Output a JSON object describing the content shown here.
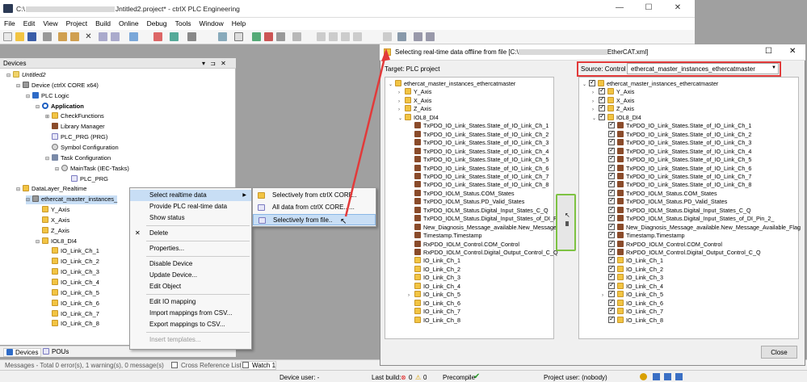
{
  "window": {
    "title_prefix": "C:\\",
    "title_suffix": "Jntitled2.project* - ctrlX PLC Engineering",
    "minimize": "—",
    "maximize": "☐",
    "close": "✕"
  },
  "menu": [
    "File",
    "Edit",
    "View",
    "Project",
    "Build",
    "Online",
    "Debug",
    "Tools",
    "Window",
    "Help"
  ],
  "devices": {
    "header": "Devices",
    "pin": "▾ ⊐ ✕",
    "tree": [
      {
        "label": "Untitled2",
        "indent": 0,
        "icon": "i-doc",
        "exp": "⊟",
        "bold": false,
        "italic": true
      },
      {
        "label": "Device (ctrlX CORE x64)",
        "indent": 1,
        "icon": "i-dev",
        "exp": "⊟"
      },
      {
        "label": "PLC Logic",
        "indent": 2,
        "icon": "i-blue",
        "exp": "⊟"
      },
      {
        "label": "Application",
        "indent": 3,
        "icon": "i-app",
        "exp": "⊟",
        "bold": true
      },
      {
        "label": "CheckFunctions",
        "indent": 4,
        "icon": "i-fold",
        "exp": "⊞"
      },
      {
        "label": "Library Manager",
        "indent": 4,
        "icon": "i-lib",
        "exp": ""
      },
      {
        "label": "PLC_PRG (PRG)",
        "indent": 4,
        "icon": "i-prg",
        "exp": ""
      },
      {
        "label": "Symbol Configuration",
        "indent": 4,
        "icon": "i-gear",
        "exp": ""
      },
      {
        "label": "Task Configuration",
        "indent": 4,
        "icon": "i-ml",
        "exp": "⊟"
      },
      {
        "label": "MainTask (IEC-Tasks)",
        "indent": 5,
        "icon": "i-gear",
        "exp": "⊟"
      },
      {
        "label": "PLC_PRG",
        "indent": 6,
        "icon": "i-prg",
        "exp": ""
      },
      {
        "label": "DataLayer_Realtime",
        "indent": 1,
        "icon": "i-fold",
        "exp": "⊟"
      },
      {
        "label": "ethercat_master_instances_",
        "indent": 2,
        "icon": "i-dev",
        "exp": "⊟"
      },
      {
        "label": "Y_Axis",
        "indent": 3,
        "icon": "i-fold",
        "exp": ""
      },
      {
        "label": "X_Axis",
        "indent": 3,
        "icon": "i-fold",
        "exp": ""
      },
      {
        "label": "Z_Axis",
        "indent": 3,
        "icon": "i-fold",
        "exp": ""
      },
      {
        "label": "IOL8_DI4",
        "indent": 3,
        "icon": "i-fold",
        "exp": "⊟"
      },
      {
        "label": "IO_Link_Ch_1",
        "indent": 4,
        "icon": "i-fold",
        "exp": ""
      },
      {
        "label": "IO_Link_Ch_2",
        "indent": 4,
        "icon": "i-fold",
        "exp": ""
      },
      {
        "label": "IO_Link_Ch_3",
        "indent": 4,
        "icon": "i-fold",
        "exp": ""
      },
      {
        "label": "IO_Link_Ch_4",
        "indent": 4,
        "icon": "i-fold",
        "exp": ""
      },
      {
        "label": "IO_Link_Ch_5",
        "indent": 4,
        "icon": "i-fold",
        "exp": ""
      },
      {
        "label": "IO_Link_Ch_6",
        "indent": 4,
        "icon": "i-fold",
        "exp": ""
      },
      {
        "label": "IO_Link_Ch_7",
        "indent": 4,
        "icon": "i-fold",
        "exp": ""
      },
      {
        "label": "IO_Link_Ch_8",
        "indent": 4,
        "icon": "i-fold",
        "exp": ""
      }
    ]
  },
  "context_menu": [
    {
      "label": "Select realtime data",
      "arrow": "▶",
      "sel": true
    },
    {
      "label": "Provide PLC real-time data"
    },
    {
      "label": "Show status"
    },
    {
      "sep": true
    },
    {
      "label": "Delete",
      "icon": "✕"
    },
    {
      "sep": true
    },
    {
      "label": "Properties..."
    },
    {
      "sep": true
    },
    {
      "label": "Disable Device"
    },
    {
      "label": "Update Device..."
    },
    {
      "label": "Edit Object"
    },
    {
      "sep": true
    },
    {
      "label": "Edit IO mapping"
    },
    {
      "label": "Import mappings from CSV..."
    },
    {
      "label": "Export mappings to CSV..."
    },
    {
      "sep": true
    },
    {
      "label": "Insert templates...",
      "disabled": true
    }
  ],
  "submenu": [
    "Selectively from ctrlX CORE..",
    "All data from ctrlX CORE......",
    "Selectively from file.."
  ],
  "bottom_tabs": [
    "Devices",
    "POUs"
  ],
  "status": {
    "messages": "Messages - Total 0 error(s), 1 warning(s), 0 message(s)",
    "cross_ref": "Cross Reference List",
    "watch": "Watch 1",
    "device_user": "Device user: -",
    "last_build": "Last build:",
    "errors": "0",
    "warnings": "0",
    "precompile": "Precompile",
    "project_user": "Project user: (nobody)"
  },
  "dialog": {
    "title_prefix": "Selecting real-time data offline from file [C:\\",
    "title_suffix": "EtherCAT.xml]",
    "target_label": "Target: PLC project",
    "source_label": "Source: Control",
    "source_value": "ethercat_master_instances_ethercatmaster",
    "close_button": "Close",
    "left_tree": [
      {
        "label": "ethercat_master_instances_ethercatmaster",
        "indent": 0,
        "exp": "⌄",
        "icon": "i-fold"
      },
      {
        "label": "Y_Axis",
        "indent": 1,
        "exp": "›",
        "icon": "i-fold"
      },
      {
        "label": "X_Axis",
        "indent": 1,
        "exp": "›",
        "icon": "i-fold"
      },
      {
        "label": "Z_Axis",
        "indent": 1,
        "exp": "›",
        "icon": "i-fold"
      },
      {
        "label": "IOL8_DI4",
        "indent": 1,
        "exp": "⌄",
        "icon": "i-fold"
      },
      {
        "label": "TxPDO_IO_Link_States.State_of_IO_Link_Ch_1",
        "indent": 2,
        "icon": "i-lib"
      },
      {
        "label": "TxPDO_IO_Link_States.State_of_IO_Link_Ch_2",
        "indent": 2,
        "icon": "i-lib"
      },
      {
        "label": "TxPDO_IO_Link_States.State_of_IO_Link_Ch_3",
        "indent": 2,
        "icon": "i-lib"
      },
      {
        "label": "TxPDO_IO_Link_States.State_of_IO_Link_Ch_4",
        "indent": 2,
        "icon": "i-lib"
      },
      {
        "label": "TxPDO_IO_Link_States.State_of_IO_Link_Ch_5",
        "indent": 2,
        "icon": "i-lib"
      },
      {
        "label": "TxPDO_IO_Link_States.State_of_IO_Link_Ch_6",
        "indent": 2,
        "icon": "i-lib"
      },
      {
        "label": "TxPDO_IO_Link_States.State_of_IO_Link_Ch_7",
        "indent": 2,
        "icon": "i-lib"
      },
      {
        "label": "TxPDO_IO_Link_States.State_of_IO_Link_Ch_8",
        "indent": 2,
        "icon": "i-lib"
      },
      {
        "label": "TxPDO_IOLM_Status.COM_States",
        "indent": 2,
        "icon": "i-lib"
      },
      {
        "label": "TxPDO_IOLM_Status.PD_Valid_States",
        "indent": 2,
        "icon": "i-lib"
      },
      {
        "label": "TxPDO_IOLM_Status.Digital_Input_States_C_Q",
        "indent": 2,
        "icon": "i-lib"
      },
      {
        "label": "TxPDO_IOLM_Status.Digital_Input_States_of_DI_Pi",
        "indent": 2,
        "icon": "i-lib"
      },
      {
        "label": "New_Diagnosis_Message_available.New_Message_",
        "indent": 2,
        "icon": "i-lib"
      },
      {
        "label": "Timestamp.Timestamp",
        "indent": 2,
        "icon": "i-lib"
      },
      {
        "label": "RxPDO_IOLM_Control.COM_Control",
        "indent": 2,
        "icon": "i-lib"
      },
      {
        "label": "RxPDO_IOLM_Control.Digital_Output_Control_C_Q",
        "indent": 2,
        "icon": "i-lib"
      },
      {
        "label": "IO_Link_Ch_1",
        "indent": 2,
        "icon": "i-fold"
      },
      {
        "label": "IO_Link_Ch_2",
        "indent": 2,
        "icon": "i-fold"
      },
      {
        "label": "IO_Link_Ch_3",
        "indent": 2,
        "icon": "i-fold"
      },
      {
        "label": "IO_Link_Ch_4",
        "indent": 2,
        "icon": "i-fold"
      },
      {
        "label": "IO_Link_Ch_5",
        "indent": 2,
        "exp": "›",
        "icon": "i-fold"
      },
      {
        "label": "IO_Link_Ch_6",
        "indent": 2,
        "icon": "i-fold"
      },
      {
        "label": "IO_Link_Ch_7",
        "indent": 2,
        "icon": "i-fold"
      },
      {
        "label": "IO_Link_Ch_8",
        "indent": 2,
        "icon": "i-fold"
      }
    ],
    "right_tree": [
      {
        "label": "ethercat_master_instances_ethercatmaster",
        "indent": 0,
        "exp": "⌄",
        "icon": "i-fold"
      },
      {
        "label": "Y_Axis",
        "indent": 1,
        "exp": "›",
        "icon": "i-fold"
      },
      {
        "label": "X_Axis",
        "indent": 1,
        "exp": "›",
        "icon": "i-fold"
      },
      {
        "label": "Z_Axis",
        "indent": 1,
        "exp": "›",
        "icon": "i-fold"
      },
      {
        "label": "IOL8_DI4",
        "indent": 1,
        "exp": "⌄",
        "icon": "i-fold"
      },
      {
        "label": "TxPDO_IO_Link_States.State_of_IO_Link_Ch_1",
        "indent": 2,
        "icon": "i-lib"
      },
      {
        "label": "TxPDO_IO_Link_States.State_of_IO_Link_Ch_2",
        "indent": 2,
        "icon": "i-lib"
      },
      {
        "label": "TxPDO_IO_Link_States.State_of_IO_Link_Ch_3",
        "indent": 2,
        "icon": "i-lib"
      },
      {
        "label": "TxPDO_IO_Link_States.State_of_IO_Link_Ch_4",
        "indent": 2,
        "icon": "i-lib"
      },
      {
        "label": "TxPDO_IO_Link_States.State_of_IO_Link_Ch_5",
        "indent": 2,
        "icon": "i-lib"
      },
      {
        "label": "TxPDO_IO_Link_States.State_of_IO_Link_Ch_6",
        "indent": 2,
        "icon": "i-lib"
      },
      {
        "label": "TxPDO_IO_Link_States.State_of_IO_Link_Ch_7",
        "indent": 2,
        "icon": "i-lib"
      },
      {
        "label": "TxPDO_IO_Link_States.State_of_IO_Link_Ch_8",
        "indent": 2,
        "icon": "i-lib"
      },
      {
        "label": "TxPDO_IOLM_Status.COM_States",
        "indent": 2,
        "icon": "i-lib"
      },
      {
        "label": "TxPDO_IOLM_Status.PD_Valid_States",
        "indent": 2,
        "icon": "i-lib"
      },
      {
        "label": "TxPDO_IOLM_Status.Digital_Input_States_C_Q",
        "indent": 2,
        "icon": "i-lib"
      },
      {
        "label": "TxPDO_IOLM_Status.Digital_Input_States_of_DI_Pin_2_",
        "indent": 2,
        "icon": "i-lib"
      },
      {
        "label": "New_Diagnosis_Message_available.New_Message_Available_Flag",
        "indent": 2,
        "icon": "i-lib"
      },
      {
        "label": "Timestamp.Timestamp",
        "indent": 2,
        "icon": "i-lib"
      },
      {
        "label": "RxPDO_IOLM_Control.COM_Control",
        "indent": 2,
        "icon": "i-lib"
      },
      {
        "label": "RxPDO_IOLM_Control.Digital_Output_Control_C_Q",
        "indent": 2,
        "icon": "i-lib"
      },
      {
        "label": "IO_Link_Ch_1",
        "indent": 2,
        "icon": "i-fold"
      },
      {
        "label": "IO_Link_Ch_2",
        "indent": 2,
        "icon": "i-fold"
      },
      {
        "label": "IO_Link_Ch_3",
        "indent": 2,
        "icon": "i-fold"
      },
      {
        "label": "IO_Link_Ch_4",
        "indent": 2,
        "icon": "i-fold"
      },
      {
        "label": "IO_Link_Ch_5",
        "indent": 2,
        "exp": "›",
        "icon": "i-fold"
      },
      {
        "label": "IO_Link_Ch_6",
        "indent": 2,
        "icon": "i-fold"
      },
      {
        "label": "IO_Link_Ch_7",
        "indent": 2,
        "icon": "i-fold"
      },
      {
        "label": "IO_Link_Ch_8",
        "indent": 2,
        "icon": "i-fold"
      }
    ]
  },
  "colors": {
    "highlight": "#c8def5",
    "annotation_red": "#e23a3a",
    "annotation_green": "#7dc242"
  }
}
